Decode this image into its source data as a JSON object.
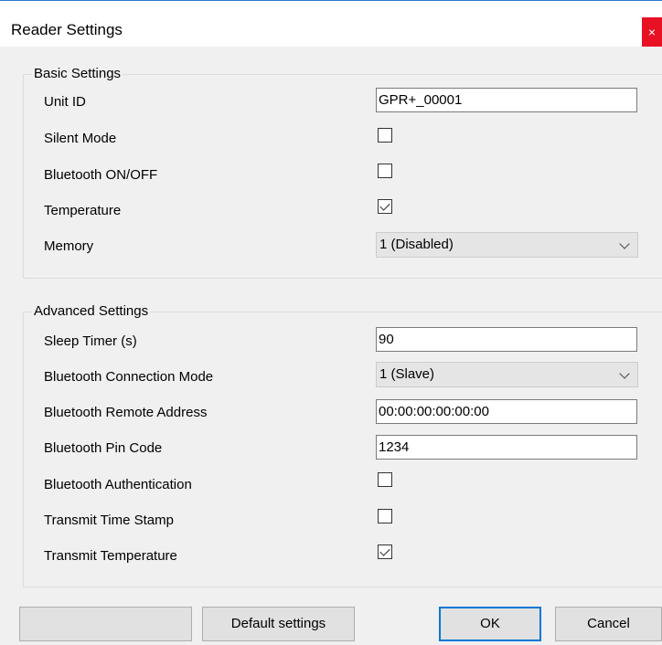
{
  "window": {
    "title": "Reader Settings",
    "close_glyph": "×"
  },
  "basic": {
    "title": "Basic Settings",
    "unit_id_label": "Unit ID",
    "unit_id_value": "GPR+_00001",
    "silent_mode_label": "Silent Mode",
    "silent_mode_checked": false,
    "bluetooth_label": "Bluetooth ON/OFF",
    "bluetooth_checked": false,
    "temperature_label": "Temperature",
    "temperature_checked": true,
    "memory_label": "Memory",
    "memory_value": "1 (Disabled)"
  },
  "advanced": {
    "title": "Advanced Settings",
    "sleep_timer_label": "Sleep Timer (s)",
    "sleep_timer_value": "90",
    "bt_conn_mode_label": "Bluetooth Connection Mode",
    "bt_conn_mode_value": "1 (Slave)",
    "bt_remote_addr_label": "Bluetooth Remote Address",
    "bt_remote_addr_value": "00:00:00:00:00:00",
    "bt_pin_label": "Bluetooth Pin Code",
    "bt_pin_value": "1234",
    "bt_auth_label": "Bluetooth Authentication",
    "bt_auth_checked": false,
    "tx_timestamp_label": "Transmit Time Stamp",
    "tx_timestamp_checked": false,
    "tx_temperature_label": "Transmit Temperature",
    "tx_temperature_checked": true
  },
  "buttons": {
    "default_label": "Default settings",
    "ok_label": "OK",
    "cancel_label": "Cancel"
  },
  "icons": [
    "close-icon",
    "chevron-down-icon",
    "checkmark-icon"
  ],
  "colors": {
    "close_red": "#e81123",
    "focus_blue": "#0078d7",
    "dialog_bg": "#f0f0f0"
  }
}
